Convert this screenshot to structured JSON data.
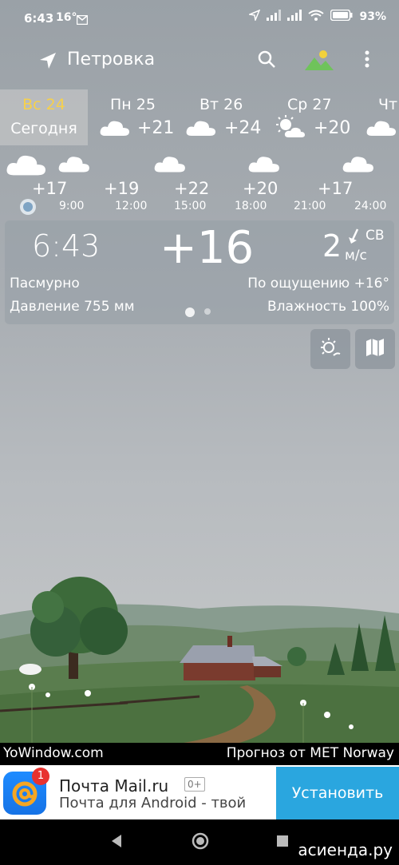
{
  "status": {
    "time": "6:43",
    "temp": "16°",
    "battery": "93%"
  },
  "app": {
    "location": "Петровка"
  },
  "days": [
    {
      "name": "Вс 24",
      "sub": "Сегодня",
      "today": true
    },
    {
      "name": "Пн 25",
      "temp": "+21",
      "icon": "cloud-icon"
    },
    {
      "name": "Вт 26",
      "temp": "+24",
      "icon": "cloud-icon"
    },
    {
      "name": "Ср 27",
      "temp": "+20",
      "icon": "partly-sunny-icon"
    },
    {
      "name": "Чт",
      "icon": "cloud-icon"
    }
  ],
  "hours": {
    "temps": [
      "+17",
      "+19",
      "+22",
      "+20",
      "+17"
    ],
    "times": [
      "9:00",
      "12:00",
      "15:00",
      "18:00",
      "21:00",
      "24:00"
    ]
  },
  "current": {
    "time": "6:43",
    "temp": "+16",
    "wind_speed": "2",
    "wind_dir": "СВ",
    "wind_unit": "м/с",
    "condition": "Пасмурно",
    "feels_like": "По ощущению +16°",
    "pressure": "Давление 755 мм",
    "humidity": "Влажность 100%"
  },
  "footer": {
    "left": "YoWindow.com",
    "right": "Прогноз от MET Norway"
  },
  "ad": {
    "title": "Почта Mail.ru",
    "age": "0+",
    "subtitle": "Почта для Android - твой",
    "button": "Установить",
    "badge": "1"
  },
  "watermark": "асиенда.ру",
  "colors": {
    "today_day": "#f7d14b",
    "ad_button": "#2aa6df"
  }
}
